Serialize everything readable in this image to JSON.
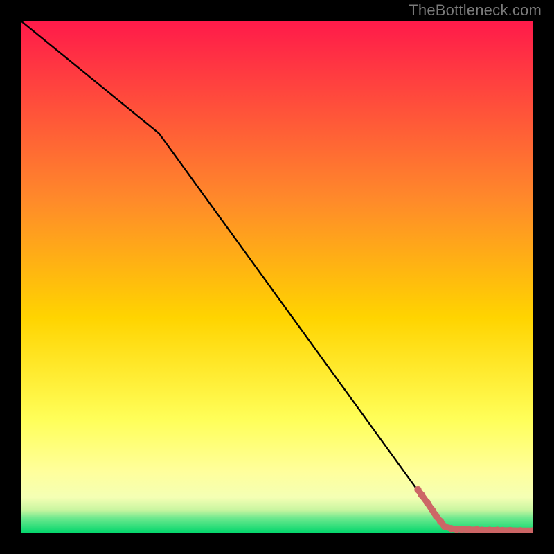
{
  "watermark": "TheBottleneck.com",
  "chart_data": {
    "type": "line",
    "title": "",
    "xlabel": "",
    "ylabel": "",
    "xlim": [
      0,
      100
    ],
    "ylim": [
      0,
      100
    ],
    "grid": false,
    "legend": false,
    "background_gradient": [
      "#ff1a4a",
      "#ff9a1f",
      "#ffe400",
      "#ffff8c",
      "#00d66b"
    ],
    "series": [
      {
        "name": "curve",
        "color": "#000000",
        "x": [
          0,
          27,
          77,
          83,
          100
        ],
        "y": [
          100,
          78,
          9,
          1,
          0.5
        ]
      }
    ],
    "highlight_points": {
      "color": "#cc6666",
      "points": [
        {
          "x": 77.5,
          "y": 8.5
        },
        {
          "x": 78.2,
          "y": 7.5
        },
        {
          "x": 79.3,
          "y": 6.0
        },
        {
          "x": 80.3,
          "y": 4.5
        },
        {
          "x": 81.1,
          "y": 3.3
        },
        {
          "x": 81.9,
          "y": 2.3
        },
        {
          "x": 82.7,
          "y": 1.3
        },
        {
          "x": 84.0,
          "y": 0.9
        },
        {
          "x": 85.0,
          "y": 0.8
        },
        {
          "x": 86.0,
          "y": 0.8
        },
        {
          "x": 87.5,
          "y": 0.7
        },
        {
          "x": 89.0,
          "y": 0.7
        },
        {
          "x": 90.0,
          "y": 0.6
        },
        {
          "x": 91.5,
          "y": 0.6
        },
        {
          "x": 93.0,
          "y": 0.6
        },
        {
          "x": 94.0,
          "y": 0.55
        },
        {
          "x": 95.5,
          "y": 0.55
        },
        {
          "x": 97.5,
          "y": 0.5
        },
        {
          "x": 100.0,
          "y": 0.5
        }
      ]
    }
  }
}
